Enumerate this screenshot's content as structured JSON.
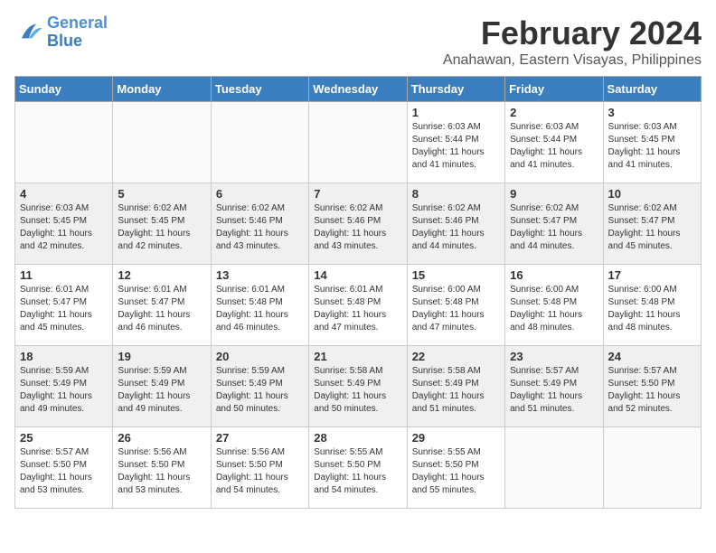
{
  "logo": {
    "line1": "General",
    "line2": "Blue"
  },
  "title": "February 2024",
  "subtitle": "Anahawan, Eastern Visayas, Philippines",
  "days_of_week": [
    "Sunday",
    "Monday",
    "Tuesday",
    "Wednesday",
    "Thursday",
    "Friday",
    "Saturday"
  ],
  "weeks": [
    [
      {
        "day": "",
        "info": ""
      },
      {
        "day": "",
        "info": ""
      },
      {
        "day": "",
        "info": ""
      },
      {
        "day": "",
        "info": ""
      },
      {
        "day": "1",
        "info": "Sunrise: 6:03 AM\nSunset: 5:44 PM\nDaylight: 11 hours\nand 41 minutes."
      },
      {
        "day": "2",
        "info": "Sunrise: 6:03 AM\nSunset: 5:44 PM\nDaylight: 11 hours\nand 41 minutes."
      },
      {
        "day": "3",
        "info": "Sunrise: 6:03 AM\nSunset: 5:45 PM\nDaylight: 11 hours\nand 41 minutes."
      }
    ],
    [
      {
        "day": "4",
        "info": "Sunrise: 6:03 AM\nSunset: 5:45 PM\nDaylight: 11 hours\nand 42 minutes."
      },
      {
        "day": "5",
        "info": "Sunrise: 6:02 AM\nSunset: 5:45 PM\nDaylight: 11 hours\nand 42 minutes."
      },
      {
        "day": "6",
        "info": "Sunrise: 6:02 AM\nSunset: 5:46 PM\nDaylight: 11 hours\nand 43 minutes."
      },
      {
        "day": "7",
        "info": "Sunrise: 6:02 AM\nSunset: 5:46 PM\nDaylight: 11 hours\nand 43 minutes."
      },
      {
        "day": "8",
        "info": "Sunrise: 6:02 AM\nSunset: 5:46 PM\nDaylight: 11 hours\nand 44 minutes."
      },
      {
        "day": "9",
        "info": "Sunrise: 6:02 AM\nSunset: 5:47 PM\nDaylight: 11 hours\nand 44 minutes."
      },
      {
        "day": "10",
        "info": "Sunrise: 6:02 AM\nSunset: 5:47 PM\nDaylight: 11 hours\nand 45 minutes."
      }
    ],
    [
      {
        "day": "11",
        "info": "Sunrise: 6:01 AM\nSunset: 5:47 PM\nDaylight: 11 hours\nand 45 minutes."
      },
      {
        "day": "12",
        "info": "Sunrise: 6:01 AM\nSunset: 5:47 PM\nDaylight: 11 hours\nand 46 minutes."
      },
      {
        "day": "13",
        "info": "Sunrise: 6:01 AM\nSunset: 5:48 PM\nDaylight: 11 hours\nand 46 minutes."
      },
      {
        "day": "14",
        "info": "Sunrise: 6:01 AM\nSunset: 5:48 PM\nDaylight: 11 hours\nand 47 minutes."
      },
      {
        "day": "15",
        "info": "Sunrise: 6:00 AM\nSunset: 5:48 PM\nDaylight: 11 hours\nand 47 minutes."
      },
      {
        "day": "16",
        "info": "Sunrise: 6:00 AM\nSunset: 5:48 PM\nDaylight: 11 hours\nand 48 minutes."
      },
      {
        "day": "17",
        "info": "Sunrise: 6:00 AM\nSunset: 5:48 PM\nDaylight: 11 hours\nand 48 minutes."
      }
    ],
    [
      {
        "day": "18",
        "info": "Sunrise: 5:59 AM\nSunset: 5:49 PM\nDaylight: 11 hours\nand 49 minutes."
      },
      {
        "day": "19",
        "info": "Sunrise: 5:59 AM\nSunset: 5:49 PM\nDaylight: 11 hours\nand 49 minutes."
      },
      {
        "day": "20",
        "info": "Sunrise: 5:59 AM\nSunset: 5:49 PM\nDaylight: 11 hours\nand 50 minutes."
      },
      {
        "day": "21",
        "info": "Sunrise: 5:58 AM\nSunset: 5:49 PM\nDaylight: 11 hours\nand 50 minutes."
      },
      {
        "day": "22",
        "info": "Sunrise: 5:58 AM\nSunset: 5:49 PM\nDaylight: 11 hours\nand 51 minutes."
      },
      {
        "day": "23",
        "info": "Sunrise: 5:57 AM\nSunset: 5:49 PM\nDaylight: 11 hours\nand 51 minutes."
      },
      {
        "day": "24",
        "info": "Sunrise: 5:57 AM\nSunset: 5:50 PM\nDaylight: 11 hours\nand 52 minutes."
      }
    ],
    [
      {
        "day": "25",
        "info": "Sunrise: 5:57 AM\nSunset: 5:50 PM\nDaylight: 11 hours\nand 53 minutes."
      },
      {
        "day": "26",
        "info": "Sunrise: 5:56 AM\nSunset: 5:50 PM\nDaylight: 11 hours\nand 53 minutes."
      },
      {
        "day": "27",
        "info": "Sunrise: 5:56 AM\nSunset: 5:50 PM\nDaylight: 11 hours\nand 54 minutes."
      },
      {
        "day": "28",
        "info": "Sunrise: 5:55 AM\nSunset: 5:50 PM\nDaylight: 11 hours\nand 54 minutes."
      },
      {
        "day": "29",
        "info": "Sunrise: 5:55 AM\nSunset: 5:50 PM\nDaylight: 11 hours\nand 55 minutes."
      },
      {
        "day": "",
        "info": ""
      },
      {
        "day": "",
        "info": ""
      }
    ]
  ]
}
